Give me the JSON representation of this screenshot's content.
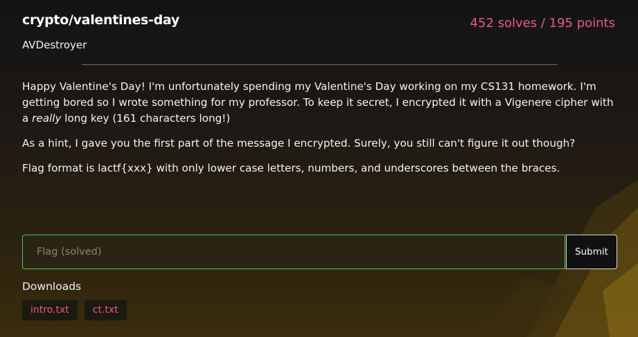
{
  "challenge": {
    "title": "crypto/valentines-day",
    "author": "AVDestroyer",
    "score": "452 solves / 195 points"
  },
  "description": {
    "p1_before": "Happy Valentine's Day! I'm unfortunately spending my Valentine's Day working on my CS131 homework. I'm getting bored so I wrote something for my professor. To keep it secret, I encrypted it with a Vigenere cipher with a ",
    "p1_emph": "really",
    "p1_after": " long key (161 characters long!)",
    "p2": "As a hint, I gave you the first part of the message I encrypted. Surely, you still can't figure it out though?",
    "p3": "Flag format is lactf{xxx} with only lower case letters, numbers, and underscores between the braces."
  },
  "flag_form": {
    "placeholder": "Flag (solved)",
    "value": "",
    "submit_label": "Submit"
  },
  "downloads": {
    "label": "Downloads",
    "files": [
      "intro.txt",
      "ct.txt"
    ]
  },
  "colors": {
    "accent": "#e85a86",
    "input_border": "#4fc35a"
  }
}
